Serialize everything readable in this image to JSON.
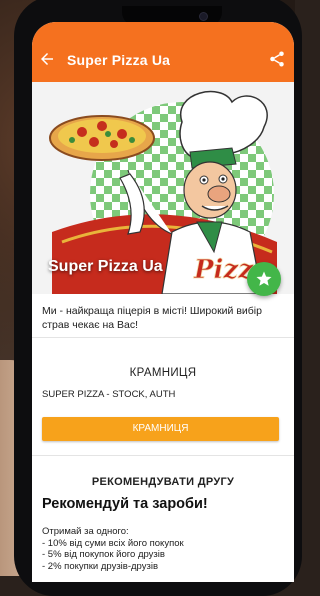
{
  "app_bar": {
    "title": "Super Pizza Ua"
  },
  "hero": {
    "title": "Super Pizza Ua",
    "logo_text": "Pizza"
  },
  "description": "Ми - найкраща піцерія в місті! Широкий вибір страв чекає на Вас!",
  "stores": {
    "heading": "КРАМНИЦЯ",
    "store_name": "SUPER PIZZA - STOCK, AUTH",
    "button_label": "КРАМНИЦЯ"
  },
  "referral": {
    "heading": "РЕКОМЕНДУВАТИ ДРУГУ",
    "headline": "Рекомендуй та зароби!",
    "lines": [
      "Отримай за одного:",
      "- 10% від суми всіх його покупок",
      "- 5% від покупок його друзів",
      "- 2% покупки друзів-друзів"
    ]
  },
  "colors": {
    "app_bar": "#f5711f",
    "button": "#f7a21b",
    "fab": "#43b649"
  },
  "icons": [
    "back-arrow-icon",
    "share-icon",
    "star-icon"
  ]
}
